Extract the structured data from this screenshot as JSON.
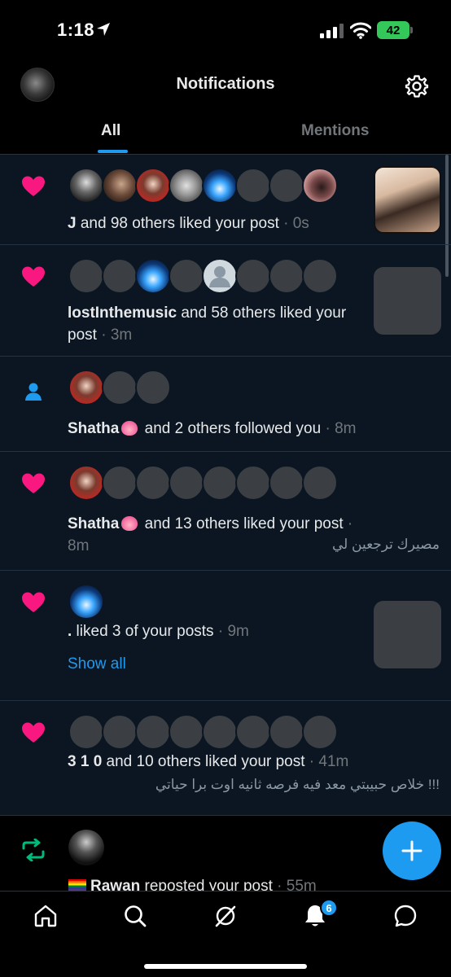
{
  "status_bar": {
    "time": "1:18",
    "battery": "42"
  },
  "header": {
    "title": "Notifications"
  },
  "tabs": [
    {
      "label": "All",
      "active": true
    },
    {
      "label": "Mentions",
      "active": false
    }
  ],
  "notifications": [
    {
      "type": "like",
      "actor": "J",
      "rest": " and 98 others liked your post",
      "time": "0s",
      "snippet": "",
      "has_thumb": true
    },
    {
      "type": "like",
      "actor": "lostInthemusic",
      "rest": " and 58 others liked your post",
      "time": "3m",
      "snippet": "",
      "has_thumb": true
    },
    {
      "type": "follow",
      "actor": "Shatha",
      "rest": " and 2 others followed you",
      "time": "8m",
      "snippet": ""
    },
    {
      "type": "like",
      "actor": "Shatha",
      "rest": " and 13 others liked your post",
      "time": "8m",
      "snippet": "مصيرك ترجعين لي"
    },
    {
      "type": "like",
      "actor": ".",
      "rest": " liked 3 of your posts",
      "time": "9m",
      "show_all": "Show all",
      "has_thumb": true
    },
    {
      "type": "like",
      "actor": "3 1 0",
      "rest": " and 10 others liked your post",
      "time": "41m",
      "snippet": "!!! خلاص حبيبتي معد فيه فرصه ثانيه اوت برا حياتي"
    },
    {
      "type": "repost",
      "actor": "Rawan",
      "rest": " reposted your post",
      "time": "55m"
    }
  ],
  "bottom_nav": {
    "notification_badge": "6"
  },
  "colors": {
    "accent": "#1d9bf0",
    "like": "#f91880",
    "repost": "#00ba7c",
    "feed_bg": "#0b1622"
  },
  "icons": [
    "location-arrow-icon",
    "signal-icon",
    "wifi-icon",
    "battery-icon",
    "gear-icon",
    "heart-icon",
    "person-icon",
    "repost-icon",
    "plus-icon",
    "home-icon",
    "search-icon",
    "grok-icon",
    "bell-icon",
    "messages-icon"
  ]
}
